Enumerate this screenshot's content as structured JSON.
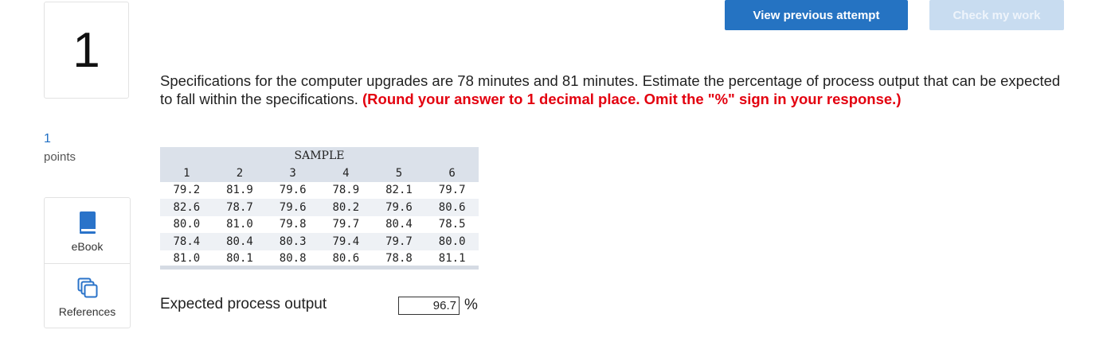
{
  "question_number": "1",
  "points": {
    "value": "1",
    "label": "points"
  },
  "tools": [
    {
      "label": "eBook",
      "icon": "book-icon",
      "color": "#2a73c9"
    },
    {
      "label": "References",
      "icon": "copy-icon",
      "color": "#2a73c9"
    }
  ],
  "buttons": {
    "view_previous": "View previous attempt",
    "check_work": "Check my work"
  },
  "question": {
    "text": "Specifications for the computer upgrades are 78 minutes and 81 minutes. Estimate the percentage of process output that can be expected to fall within the specifications. ",
    "hint": "(Round your answer to 1 decimal place. Omit the \"%\" sign in your response.)"
  },
  "table": {
    "title": "SAMPLE",
    "columns": [
      "1",
      "2",
      "3",
      "4",
      "5",
      "6"
    ],
    "rows": [
      [
        "79.2",
        "81.9",
        "79.6",
        "78.9",
        "82.1",
        "79.7"
      ],
      [
        "82.6",
        "78.7",
        "79.6",
        "80.2",
        "79.6",
        "80.6"
      ],
      [
        "80.0",
        "81.0",
        "79.8",
        "79.7",
        "80.4",
        "78.5"
      ],
      [
        "78.4",
        "80.4",
        "80.3",
        "79.4",
        "79.7",
        "80.0"
      ],
      [
        "81.0",
        "80.1",
        "80.8",
        "80.6",
        "78.8",
        "81.1"
      ]
    ]
  },
  "answer": {
    "label": "Expected process output",
    "value": "96.7",
    "unit": "%"
  },
  "colors": {
    "primary_button": "#2573c2",
    "disabled_button": "#c8dcf0",
    "hint_red": "#e3000f",
    "points_blue": "#1f6fc4"
  }
}
